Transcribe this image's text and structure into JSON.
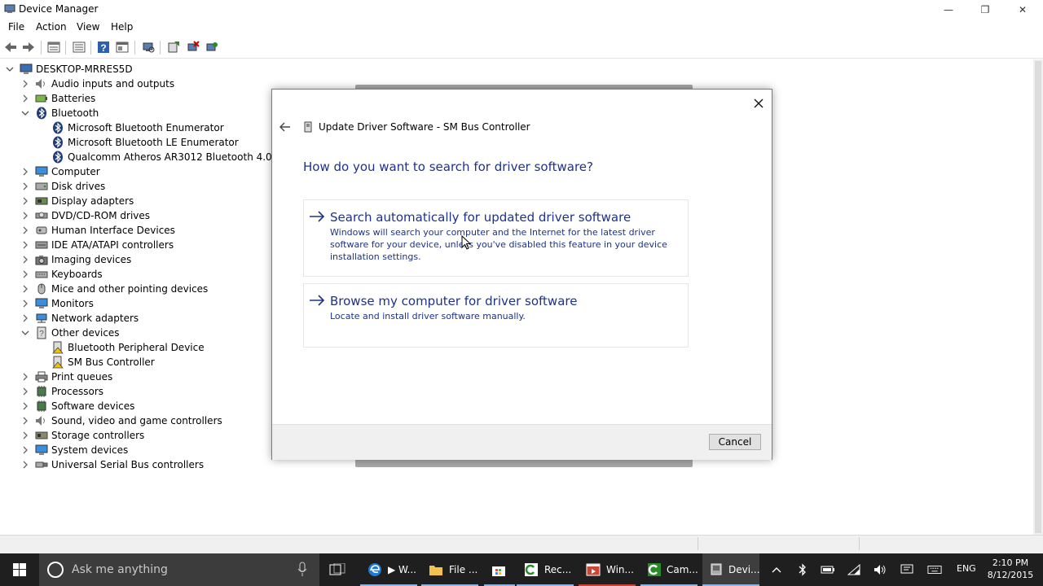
{
  "window": {
    "title": "Device Manager",
    "controls": {
      "minimize": "—",
      "restore": "❐",
      "close": "✕"
    }
  },
  "menu": [
    "File",
    "Action",
    "View",
    "Help"
  ],
  "toolbar": [
    "back-icon",
    "forward-icon",
    "properties-icon",
    "show-hide-icon",
    "help-icon",
    "view-icon",
    "scan-hardware-icon",
    "update-driver-icon",
    "uninstall-icon",
    "enable-device-icon"
  ],
  "tree": {
    "root": "DESKTOP-MRRES5D",
    "items": [
      {
        "label": "Audio inputs and outputs",
        "icon": "speaker-icon",
        "expanded": false
      },
      {
        "label": "Batteries",
        "icon": "battery-icon",
        "expanded": false
      },
      {
        "label": "Bluetooth",
        "icon": "bluetooth-icon",
        "expanded": true
      },
      {
        "label": "Microsoft Bluetooth Enumerator",
        "icon": "bluetooth-icon",
        "child": true
      },
      {
        "label": "Microsoft Bluetooth LE Enumerator",
        "icon": "bluetooth-icon",
        "child": true
      },
      {
        "label": "Qualcomm Atheros AR3012 Bluetooth 4.0",
        "icon": "bluetooth-icon",
        "child": true
      },
      {
        "label": "Computer",
        "icon": "monitor-icon",
        "expanded": false
      },
      {
        "label": "Disk drives",
        "icon": "disk-icon",
        "expanded": false
      },
      {
        "label": "Display adapters",
        "icon": "display-adapter-icon",
        "expanded": false
      },
      {
        "label": "DVD/CD-ROM drives",
        "icon": "dvd-icon",
        "expanded": false
      },
      {
        "label": "Human Interface Devices",
        "icon": "hid-icon",
        "expanded": false
      },
      {
        "label": "IDE ATA/ATAPI controllers",
        "icon": "ide-icon",
        "expanded": false
      },
      {
        "label": "Imaging devices",
        "icon": "camera-icon",
        "expanded": false
      },
      {
        "label": "Keyboards",
        "icon": "keyboard-icon",
        "expanded": false
      },
      {
        "label": "Mice and other pointing devices",
        "icon": "mouse-icon",
        "expanded": false
      },
      {
        "label": "Monitors",
        "icon": "monitor-icon",
        "expanded": false
      },
      {
        "label": "Network adapters",
        "icon": "network-icon",
        "expanded": false
      },
      {
        "label": "Other devices",
        "icon": "unknown-device-icon",
        "expanded": true
      },
      {
        "label": "Bluetooth Peripheral Device",
        "icon": "warning-device-icon",
        "child": true
      },
      {
        "label": "SM Bus Controller",
        "icon": "warning-device-icon",
        "child": true
      },
      {
        "label": "Print queues",
        "icon": "printer-icon",
        "expanded": false
      },
      {
        "label": "Processors",
        "icon": "chip-icon",
        "expanded": false
      },
      {
        "label": "Software devices",
        "icon": "chip-icon",
        "expanded": false
      },
      {
        "label": "Sound, video and game controllers",
        "icon": "speaker-icon",
        "expanded": false
      },
      {
        "label": "Storage controllers",
        "icon": "storage-icon",
        "expanded": false
      },
      {
        "label": "System devices",
        "icon": "monitor-icon",
        "expanded": false
      },
      {
        "label": "Universal Serial Bus controllers",
        "icon": "usb-icon",
        "expanded": false
      }
    ]
  },
  "dialog": {
    "title": "Update Driver Software - SM Bus Controller",
    "question": "How do you want to search for driver software?",
    "option1": {
      "title": "Search automatically for updated driver software",
      "desc": "Windows will search your computer and the Internet for the latest driver software for your device, unless you've disabled this feature in your device installation settings."
    },
    "option2": {
      "title": "Browse my computer for driver software",
      "desc": "Locate and install driver software manually."
    },
    "cancel": "Cancel"
  },
  "taskbar": {
    "search_placeholder": "Ask me anything",
    "buttons": [
      {
        "label": "▶ W...",
        "icon": "edge-icon"
      },
      {
        "label": "File ...",
        "icon": "folder-icon"
      },
      {
        "label": "",
        "icon": "store-icon"
      },
      {
        "label": "Rec...",
        "icon": "camtasia-recorder-icon"
      },
      {
        "label": "Win...",
        "icon": "window-icon"
      },
      {
        "label": "Cam...",
        "icon": "camtasia-icon"
      },
      {
        "label": "Devi...",
        "icon": "device-manager-icon"
      }
    ],
    "language": "ENG",
    "time": "2:10 PM",
    "date": "8/12/2015"
  },
  "colors": {
    "link_blue": "#1e3287",
    "taskbar": "#1f1f1f",
    "search_box": "#3c3c3c"
  }
}
